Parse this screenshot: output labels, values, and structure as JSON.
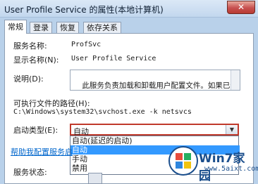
{
  "window": {
    "title": "User Profile Service 的属性(本地计算机)",
    "close_glyph": "✕"
  },
  "tabs": [
    {
      "label": "常规"
    },
    {
      "label": "登录"
    },
    {
      "label": "恢复"
    },
    {
      "label": "依存关系"
    }
  ],
  "general": {
    "service_name_label": "服务名称:",
    "service_name_value": "ProfSvc",
    "display_name_label": "显示名称(N):",
    "display_name_value": "User Profile Service",
    "description_label": "说明(D):",
    "description_value": "此服务负责加载和卸载用户配置文件。如果已停止或禁用此服务，用户将无法再成功登录或",
    "exe_path_label": "可执行文件的路径(H):",
    "exe_path_value": "C:\\Windows\\system32\\svchost.exe -k netsvcs",
    "startup_type_label": "启动类型(E):",
    "startup_type_value": "自动",
    "startup_options": [
      "自动(延迟的启动)",
      "自动",
      "手动",
      "禁用"
    ],
    "startup_selected_index": 1,
    "help_link": "帮助我配置服务启",
    "service_status_label": "服务状态:"
  },
  "watermark": {
    "brand": "Win7家园",
    "url": "www.5aixt.com"
  },
  "colors": {
    "highlight_border": "#c0392b",
    "selection": "#3399ff",
    "link": "#0066cc"
  }
}
